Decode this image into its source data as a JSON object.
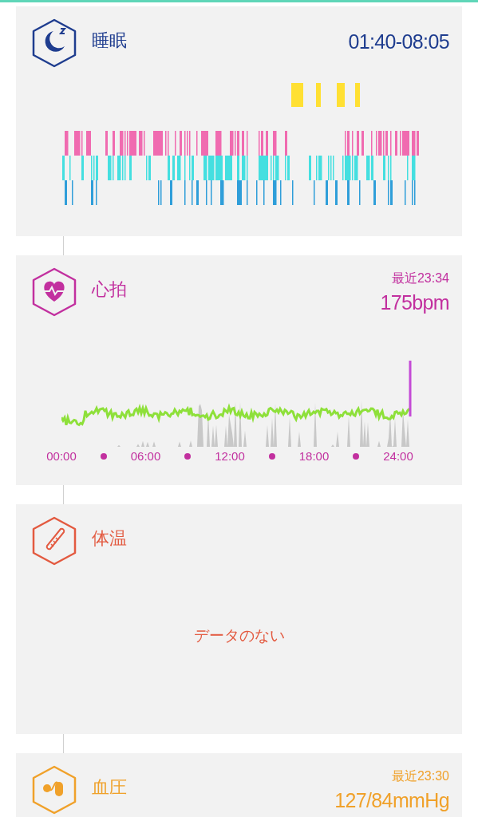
{
  "cards": [
    {
      "kind": "sleep",
      "color": "#1f3d8f",
      "title": "睡眠",
      "value": "01:40-08:05"
    },
    {
      "kind": "heart",
      "color": "#c2309f",
      "title": "心拍",
      "recent": "最近23:34",
      "value": "175bpm",
      "x_ticks": [
        "00:00",
        "06:00",
        "12:00",
        "18:00",
        "24:00"
      ]
    },
    {
      "kind": "temperature",
      "color": "#e35a40",
      "title": "体温",
      "empty_message": "データのない"
    },
    {
      "kind": "blood_pressure",
      "color": "#f0a12a",
      "title": "血圧",
      "recent": "最近23:30",
      "value": "127/84mmHg"
    }
  ]
}
